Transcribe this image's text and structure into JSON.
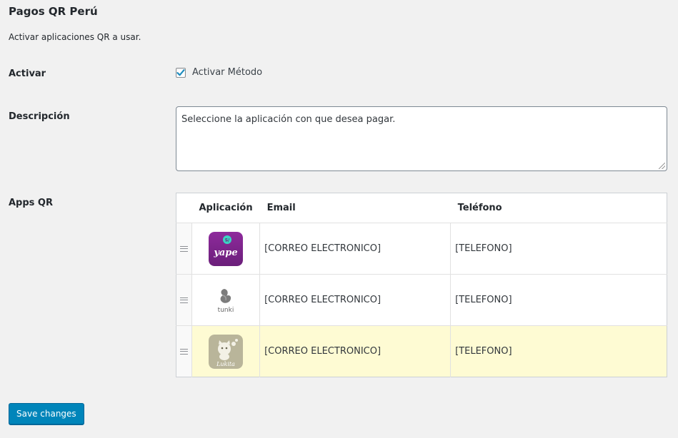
{
  "page": {
    "title": "Pagos QR Perú",
    "subtitle": "Activar aplicaciones QR a usar."
  },
  "activar": {
    "label": "Activar",
    "checkbox_label": "Activar Método",
    "checked": true
  },
  "descripcion": {
    "label": "Descripción",
    "value": "Seleccione la aplicación con que desea pagar."
  },
  "apps": {
    "label": "Apps QR",
    "columns": {
      "app": "Aplicación",
      "email": "Email",
      "phone": "Teléfono"
    },
    "rows": [
      {
        "logo": "yape-logo-icon",
        "email": "[CORREO ELECTRONICO]",
        "phone": "[TELEFONO]",
        "highlighted": false
      },
      {
        "logo": "tunki-logo-icon",
        "email": "[CORREO ELECTRONICO]",
        "phone": "[TELEFONO]",
        "highlighted": false
      },
      {
        "logo": "lukita-logo-icon",
        "email": "[CORREO ELECTRONICO]",
        "phone": "[TELEFONO]",
        "highlighted": true
      }
    ],
    "logo_text": {
      "yape": "yape",
      "tunki": "tunki",
      "lukita": "Lukita"
    }
  },
  "save_label": "Save changes",
  "colors": {
    "accent": "#0085ba",
    "highlight_row": "#fefbd3",
    "yape_purple": "#742384",
    "lukita_gray": "#b9b59a"
  }
}
